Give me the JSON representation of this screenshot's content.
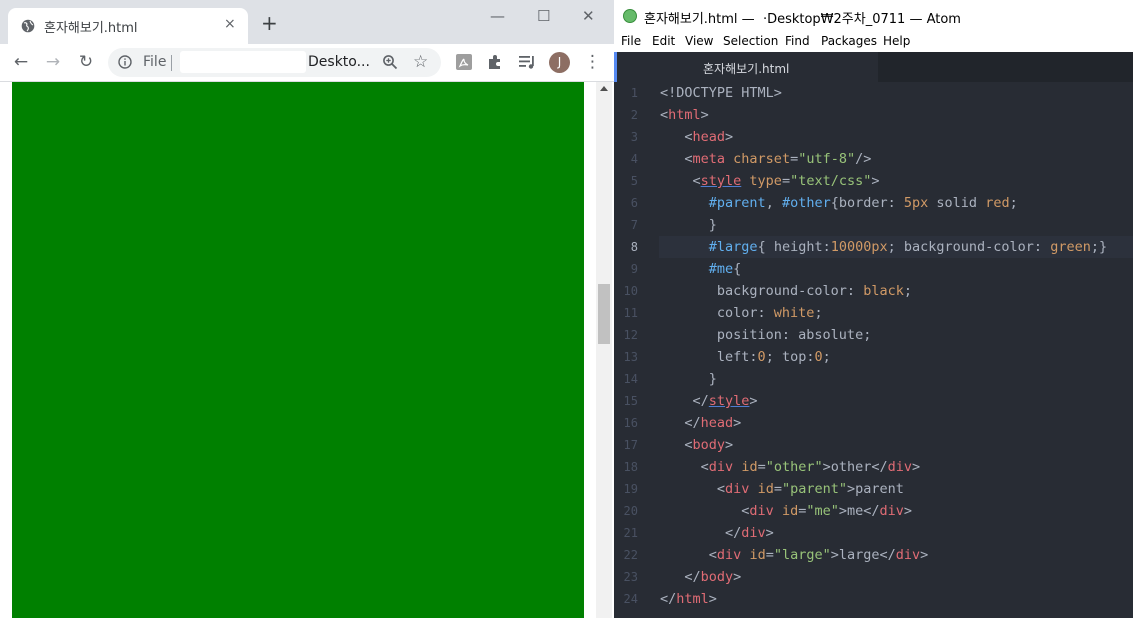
{
  "chrome": {
    "tab_title": "혼자해보기.html",
    "tab_close": "×",
    "new_tab": "+",
    "minimize": "—",
    "maximize": "☐",
    "close": "✕",
    "back": "←",
    "forward": "→",
    "reload": "↻",
    "scheme_label": "File",
    "url": "Deskto...",
    "star": "☆",
    "avatar_letter": "J",
    "menu": "⋮",
    "page_background": "#008000"
  },
  "atom": {
    "title": "혼자해보기.html — ‌                              ·Desktop₩2주차_0711 — Atom",
    "menu": [
      "File",
      "Edit",
      "View",
      "Selection",
      "Find",
      "Packages",
      "Help"
    ],
    "tab_title": "혼자해보기.html",
    "active_line": 8,
    "lines": [
      {
        "n": "1",
        "tokens": [
          [
            "p",
            "<!DOCTYPE HTML>"
          ]
        ]
      },
      {
        "n": "2",
        "tokens": [
          [
            "p",
            "<"
          ],
          [
            "tag",
            "html"
          ],
          [
            "p",
            ">"
          ]
        ]
      },
      {
        "n": "3",
        "tokens": [
          [
            "p",
            "   <"
          ],
          [
            "tag",
            "head"
          ],
          [
            "p",
            ">"
          ]
        ]
      },
      {
        "n": "4",
        "tokens": [
          [
            "p",
            "   <"
          ],
          [
            "tag",
            "meta"
          ],
          [
            "p",
            " "
          ],
          [
            "attr",
            "charset"
          ],
          [
            "p",
            "="
          ],
          [
            "str",
            "\"utf-8\""
          ],
          [
            "p",
            "/>"
          ]
        ]
      },
      {
        "n": "5",
        "tokens": [
          [
            "p",
            "    <"
          ],
          [
            "tagu",
            "style"
          ],
          [
            "p",
            " "
          ],
          [
            "attr",
            "type"
          ],
          [
            "p",
            "="
          ],
          [
            "str",
            "\"text/css\""
          ],
          [
            "p",
            ">"
          ]
        ]
      },
      {
        "n": "6",
        "tokens": [
          [
            "p",
            "      "
          ],
          [
            "id",
            "#parent"
          ],
          [
            "p",
            ", "
          ],
          [
            "id",
            "#other"
          ],
          [
            "p",
            "{border: "
          ],
          [
            "num",
            "5px"
          ],
          [
            "p",
            " solid "
          ],
          [
            "val",
            "red"
          ],
          [
            "p",
            ";"
          ]
        ]
      },
      {
        "n": "7",
        "tokens": [
          [
            "p",
            "      }"
          ]
        ]
      },
      {
        "n": "8",
        "tokens": [
          [
            "p",
            "      "
          ],
          [
            "id",
            "#large"
          ],
          [
            "p",
            "{ height:"
          ],
          [
            "num",
            "10000px"
          ],
          [
            "p",
            "; background-color: "
          ],
          [
            "val",
            "green"
          ],
          [
            "p",
            ";}"
          ]
        ]
      },
      {
        "n": "9",
        "tokens": [
          [
            "p",
            "      "
          ],
          [
            "id",
            "#me"
          ],
          [
            "p",
            "{"
          ]
        ]
      },
      {
        "n": "10",
        "tokens": [
          [
            "p",
            "       background-color: "
          ],
          [
            "val",
            "black"
          ],
          [
            "p",
            ";"
          ]
        ]
      },
      {
        "n": "11",
        "tokens": [
          [
            "p",
            "       color: "
          ],
          [
            "val",
            "white"
          ],
          [
            "p",
            ";"
          ]
        ]
      },
      {
        "n": "12",
        "tokens": [
          [
            "p",
            "       position: absolute;"
          ]
        ]
      },
      {
        "n": "13",
        "tokens": [
          [
            "p",
            "       left:"
          ],
          [
            "num",
            "0"
          ],
          [
            "p",
            "; top:"
          ],
          [
            "num",
            "0"
          ],
          [
            "p",
            ";"
          ]
        ]
      },
      {
        "n": "14",
        "tokens": [
          [
            "p",
            "      }"
          ]
        ]
      },
      {
        "n": "15",
        "tokens": [
          [
            "p",
            "    </"
          ],
          [
            "tagu",
            "style"
          ],
          [
            "p",
            ">"
          ]
        ]
      },
      {
        "n": "16",
        "tokens": [
          [
            "p",
            "   </"
          ],
          [
            "tag",
            "head"
          ],
          [
            "p",
            ">"
          ]
        ]
      },
      {
        "n": "17",
        "tokens": [
          [
            "p",
            "   <"
          ],
          [
            "tag",
            "body"
          ],
          [
            "p",
            ">"
          ]
        ]
      },
      {
        "n": "18",
        "tokens": [
          [
            "p",
            "     <"
          ],
          [
            "tag",
            "div"
          ],
          [
            "p",
            " "
          ],
          [
            "attr",
            "id"
          ],
          [
            "p",
            "="
          ],
          [
            "str",
            "\"other\""
          ],
          [
            "p",
            ">other</"
          ],
          [
            "tag",
            "div"
          ],
          [
            "p",
            ">"
          ]
        ]
      },
      {
        "n": "19",
        "tokens": [
          [
            "p",
            "       <"
          ],
          [
            "tag",
            "div"
          ],
          [
            "p",
            " "
          ],
          [
            "attr",
            "id"
          ],
          [
            "p",
            "="
          ],
          [
            "str",
            "\"parent\""
          ],
          [
            "p",
            ">parent"
          ]
        ]
      },
      {
        "n": "20",
        "tokens": [
          [
            "p",
            "          <"
          ],
          [
            "tag",
            "div"
          ],
          [
            "p",
            " "
          ],
          [
            "attr",
            "id"
          ],
          [
            "p",
            "="
          ],
          [
            "str",
            "\"me\""
          ],
          [
            "p",
            ">me</"
          ],
          [
            "tag",
            "div"
          ],
          [
            "p",
            ">"
          ]
        ]
      },
      {
        "n": "21",
        "tokens": [
          [
            "p",
            "        </"
          ],
          [
            "tag",
            "div"
          ],
          [
            "p",
            ">"
          ]
        ]
      },
      {
        "n": "22",
        "tokens": [
          [
            "p",
            "      <"
          ],
          [
            "tag",
            "div"
          ],
          [
            "p",
            " "
          ],
          [
            "attr",
            "id"
          ],
          [
            "p",
            "="
          ],
          [
            "str",
            "\"large\""
          ],
          [
            "p",
            ">large</"
          ],
          [
            "tag",
            "div"
          ],
          [
            "p",
            ">"
          ]
        ]
      },
      {
        "n": "23",
        "tokens": [
          [
            "p",
            "   </"
          ],
          [
            "tag",
            "body"
          ],
          [
            "p",
            ">"
          ]
        ]
      },
      {
        "n": "24",
        "tokens": [
          [
            "p",
            "</"
          ],
          [
            "tag",
            "html"
          ],
          [
            "p",
            ">"
          ]
        ]
      }
    ]
  }
}
